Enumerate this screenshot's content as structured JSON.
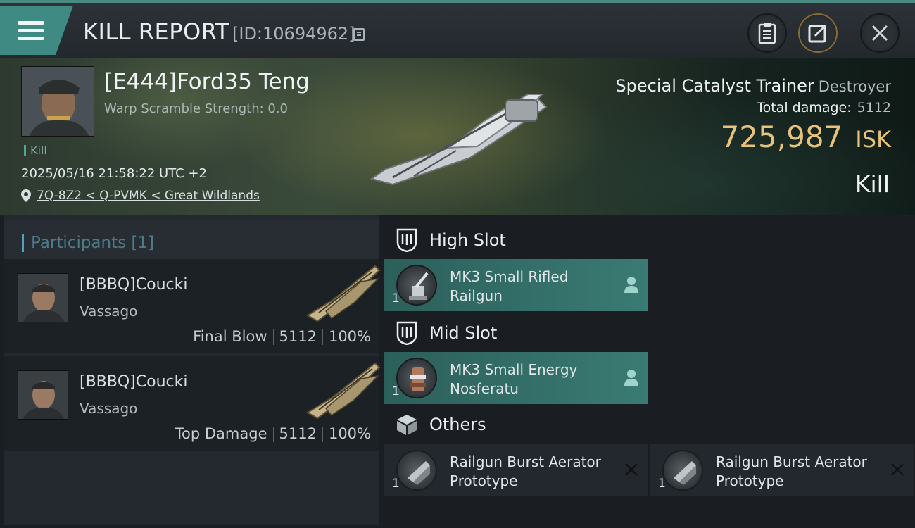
{
  "header": {
    "title": "KILL REPORT",
    "report_id": "[ID:10694962]"
  },
  "victim": {
    "name": "[E444]Ford35 Teng",
    "warp_scramble": "Warp Scramble Strength: 0.0",
    "kill_tag": "Kill",
    "datetime": "2025/05/16 21:58:22 UTC +2",
    "location": "7Q-8Z2 < Q-PVMK < Great Wildlands",
    "ship_name": "Special Catalyst Trainer",
    "ship_class": "Destroyer",
    "total_damage_label": "Total damage:",
    "total_damage": "5112",
    "isk_value": "725,987",
    "isk_unit": "ISK",
    "result": "Kill"
  },
  "participants": {
    "title": "Participants [1]",
    "rows": [
      {
        "name": "[BBBQ]Coucki",
        "ship": "Vassago",
        "role": "Final Blow",
        "damage": "5112",
        "percent": "100%"
      },
      {
        "name": "[BBBQ]Coucki",
        "ship": "Vassago",
        "role": "Top Damage",
        "damage": "5112",
        "percent": "100%"
      }
    ]
  },
  "slots": {
    "high": {
      "label": "High Slot",
      "items": [
        {
          "name": "MK3 Small Rifled Railgun",
          "qty": "1"
        }
      ]
    },
    "mid": {
      "label": "Mid Slot",
      "items": [
        {
          "name": "MK3 Small Energy Nosferatu",
          "qty": "1"
        }
      ]
    },
    "others": {
      "label": "Others",
      "items": [
        {
          "name": "Railgun Burst Aerator Prototype",
          "qty": "1"
        },
        {
          "name": "Railgun Burst Aerator Prototype",
          "qty": "1"
        }
      ]
    }
  },
  "colors": {
    "accent_teal": "#3f8a83",
    "isk_gold": "#e8c27a",
    "participants_title": "#4e7a87"
  }
}
